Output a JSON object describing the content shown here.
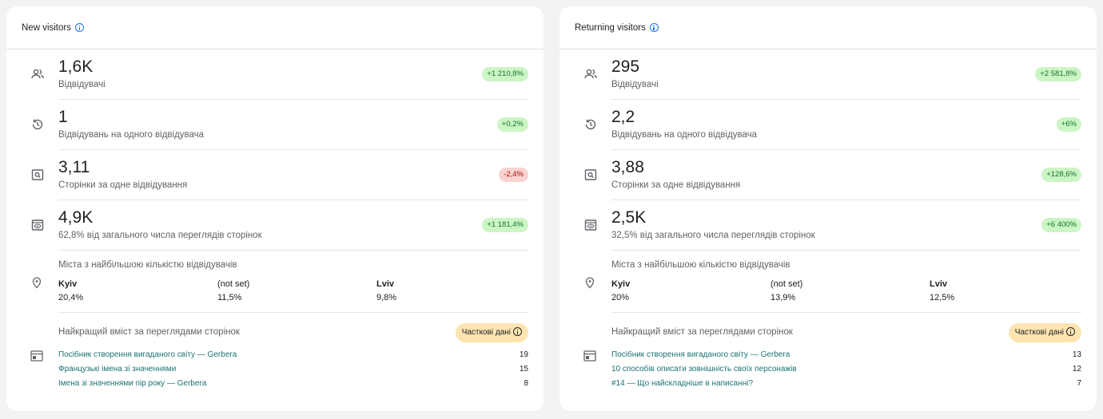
{
  "cards": [
    {
      "title": "New visitors",
      "metrics": [
        {
          "value": "1,6K",
          "label": "Відвідувачі",
          "change": "+1 210,8%",
          "trend": "up",
          "icon": "people-icon"
        },
        {
          "value": "1",
          "label": "Відвідувань на одного відвідувача",
          "change": "+0,2%",
          "trend": "up",
          "icon": "history-icon"
        },
        {
          "value": "3,11",
          "label": "Сторінки за одне відвідування",
          "change": "-2,4%",
          "trend": "down",
          "icon": "page-search-icon"
        },
        {
          "value": "4,9K",
          "label": "62,8% від загального числа переглядів сторінок",
          "change": "+1 181,4%",
          "trend": "up",
          "icon": "eye-page-icon"
        }
      ],
      "cities_title": "Міста з найбільшою кількістю відвідувачів",
      "cities": [
        {
          "name": "Kyiv",
          "share": "20,4%"
        },
        {
          "name": "(not set)",
          "share": "11,5%"
        },
        {
          "name": "Lviv",
          "share": "9,8%"
        }
      ],
      "content_title": "Найкращий вміст за переглядами сторінок",
      "partial_label": "Часткові дані",
      "pages": [
        {
          "title": "Посібник створення вигаданого світу — Gerbera",
          "views": "19"
        },
        {
          "title": "Французькі імена зі значеннями",
          "views": "15"
        },
        {
          "title": "Імена зі значеннями пір року — Gerbera",
          "views": "8"
        }
      ]
    },
    {
      "title": "Returning visitors",
      "metrics": [
        {
          "value": "295",
          "label": "Відвідувачі",
          "change": "+2 581,8%",
          "trend": "up",
          "icon": "people-icon"
        },
        {
          "value": "2,2",
          "label": "Відвідувань на одного відвідувача",
          "change": "+6%",
          "trend": "up",
          "icon": "history-icon"
        },
        {
          "value": "3,88",
          "label": "Сторінки за одне відвідування",
          "change": "+128,6%",
          "trend": "up",
          "icon": "page-search-icon"
        },
        {
          "value": "2,5K",
          "label": "32,5% від загального числа переглядів сторінок",
          "change": "+6 400%",
          "trend": "up",
          "icon": "eye-page-icon"
        }
      ],
      "cities_title": "Міста з найбільшою кількістю відвідувачів",
      "cities": [
        {
          "name": "Kyiv",
          "share": "20%"
        },
        {
          "name": "(not set)",
          "share": "13,9%"
        },
        {
          "name": "Lviv",
          "share": "12,5%"
        }
      ],
      "content_title": "Найкращий вміст за переглядами сторінок",
      "partial_label": "Часткові дані",
      "pages": [
        {
          "title": "Посібник створення вигаданого світу — Gerbera",
          "views": "13"
        },
        {
          "title": "10 способів описати зовнішність своїх персонажів",
          "views": "12"
        },
        {
          "title": "#14 — Що найскладніше в написанні?",
          "views": "7"
        }
      ]
    }
  ],
  "colors": {
    "positive_chip": "#ccf5c4",
    "negative_chip": "#fad2cf",
    "partial_chip": "#fde4b1",
    "link": "#1a7371"
  }
}
